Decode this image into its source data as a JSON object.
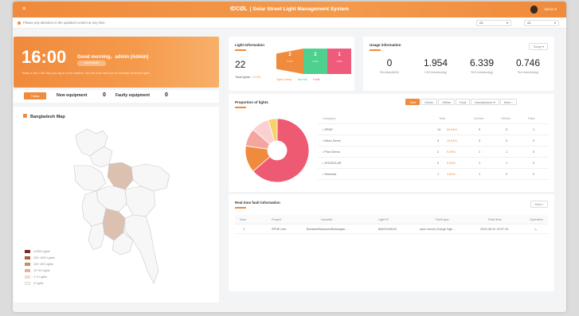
{
  "header": {
    "logo": "IDCØL",
    "title": "| Solar Street Light Management System",
    "user": "admin"
  },
  "notice": {
    "message": "Please pay attention to the updated content at any time.",
    "filter1": "All",
    "filter2": "All"
  },
  "greeting": {
    "time": "16:00",
    "hello": "Good morning，admin (Admin)",
    "date": "2024-06-02",
    "subtitle": "Today is life 1 MB day you log in to the system. We will work with you to maintain all street lights."
  },
  "today": {
    "badge": "Today",
    "new_label": "New equipment",
    "new_value": "0",
    "faulty_label": "Faulty equipment",
    "faulty_value": "0"
  },
  "map": {
    "title": "Bangladesh Map",
    "legend": [
      {
        "label": "≥1000 Lights",
        "color": "#7a2e1e"
      },
      {
        "label": "200~1000 Lights",
        "color": "#a95c3e"
      },
      {
        "label": "100~200 Lights",
        "color": "#c98a6a"
      },
      {
        "label": "10~99 Lights",
        "color": "#dcb39c"
      },
      {
        "label": "1~9 Lights",
        "color": "#eedad0"
      },
      {
        "label": "0 Lights",
        "color": "#f6f6f6"
      }
    ]
  },
  "light_info": {
    "title": "Light Information",
    "total_value": "22",
    "total_label": "Total lights",
    "total_rate": "9.0%",
    "segments": [
      {
        "value": "2",
        "pct": "9.1%",
        "label": "Open Lamp",
        "color": "#f08a3c"
      },
      {
        "value": "2",
        "pct": "9.1%",
        "label": "Normal",
        "color": "#4fd08e"
      },
      {
        "value": "1",
        "pct": "4.5%",
        "label": "Fault",
        "color": "#ef5b7a"
      }
    ]
  },
  "usage": {
    "title": "Usage information",
    "period": "Today ▾",
    "cells": [
      {
        "value": "0",
        "label": "Electricity(kWh)"
      },
      {
        "value": "1.954",
        "label": "CO2 reduction(kg)"
      },
      {
        "value": "6.339",
        "label": "SO2 reduction(kg)"
      },
      {
        "value": "0.746",
        "label": "Fire reduction(kg)"
      }
    ]
  },
  "proportion": {
    "title": "Proportion of lights",
    "tabs": [
      "Total",
      "Online",
      "Offline",
      "Fault",
      "Manufacturer ▾",
      "More ›"
    ],
    "columns": [
      "Company",
      "Total",
      "On-line",
      "Off-line",
      "Fault"
    ],
    "rows": [
      {
        "name": "• SPNE",
        "total": "14",
        "pct": "63.64%",
        "on": "9",
        "off": "5",
        "fault": "1"
      },
      {
        "name": "• Meso Demo",
        "total": "3",
        "pct": "13.64%",
        "on": "3",
        "off": "0",
        "fault": "0"
      },
      {
        "name": "• Pixel Demo",
        "total": "2",
        "pct": "9.09%",
        "on": "1",
        "off": "1",
        "fault": "0"
      },
      {
        "name": "• JEDISOLAR",
        "total": "2",
        "pct": "9.09%",
        "on": "1",
        "off": "1",
        "fault": "0"
      },
      {
        "name": "• Seesolar",
        "total": "1",
        "pct": "4.54%",
        "on": "1",
        "off": "0",
        "fault": "0"
      }
    ]
  },
  "chart_data": {
    "type": "pie",
    "categories": [
      "SPNE",
      "Meso Demo",
      "Pixel Demo",
      "JEDISOLAR",
      "Seesolar"
    ],
    "values": [
      14,
      3,
      2,
      2,
      1
    ],
    "colors": [
      "#ee5a72",
      "#f08a3c",
      "#f4a5a0",
      "#fbd0d0",
      "#f6d26a"
    ]
  },
  "fault": {
    "title": "Real time fault information",
    "more": "More ›",
    "columns": [
      "Num",
      "Project",
      "Useaddr",
      "Light ID",
      "Fault type",
      "Fault time",
      "Operation"
    ],
    "rows": [
      {
        "num": "1",
        "project": "SPNE new",
        "addr": "Banaswi/Banaswi/Babangan...",
        "id": "86400158122",
        "type": "open circuit,Charge high ...",
        "time": "2023-08-22 15:07:15",
        "op": "✎"
      }
    ]
  }
}
